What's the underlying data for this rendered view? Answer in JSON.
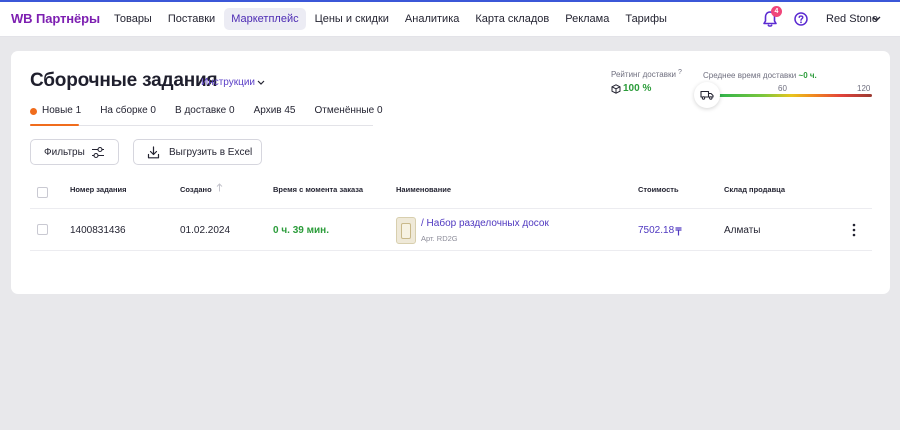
{
  "header": {
    "logo": "WB Партнёры",
    "nav": [
      {
        "label": "Товары",
        "active": false
      },
      {
        "label": "Поставки",
        "active": false
      },
      {
        "label": "Маркетплейс",
        "active": true
      },
      {
        "label": "Цены и скидки",
        "active": false
      },
      {
        "label": "Аналитика",
        "active": false
      },
      {
        "label": "Карта складов",
        "active": false
      },
      {
        "label": "Реклама",
        "active": false
      },
      {
        "label": "Тарифы",
        "active": false
      }
    ],
    "notifications_count": "4",
    "user_name": "Red Stone",
    "icons": {
      "notifications": "bell-icon",
      "help": "help-circle-icon",
      "user_menu": "chevron-down-icon"
    }
  },
  "page": {
    "title": "Сборочные задания",
    "instructions_label": "Инструкции",
    "tabs": [
      {
        "label": "Новые 1",
        "active": true
      },
      {
        "label": "На сборке 0",
        "active": false
      },
      {
        "label": "В доставке 0",
        "active": false
      },
      {
        "label": "Архив 45",
        "active": false
      },
      {
        "label": "Отменённые 0",
        "active": false
      }
    ],
    "delivery_rating": {
      "label": "Рейтинг доставки",
      "hint": "?",
      "value": "100 %"
    },
    "avg_delivery": {
      "label": "Среднее время доставки",
      "value": "~0 ч.",
      "scale_mid": "60",
      "scale_max": "120"
    },
    "buttons": {
      "filters": "Фильтры",
      "export": "Выгрузить в Excel"
    },
    "table": {
      "columns": [
        "Номер задания",
        "Создано",
        "Время с момента заказа",
        "Наименование",
        "Стоимость",
        "Склад продавца"
      ],
      "rows": [
        {
          "id": "1400831436",
          "created": "01.02.2024",
          "time_since_order": "0 ч. 39 мин.",
          "name": "/ Набор разделочных досок",
          "article": "Арт. RD2G",
          "price": "7502.18",
          "currency_sign": "₸",
          "warehouse": "Алматы"
        }
      ]
    }
  },
  "colors": {
    "accent": "#4f38c0",
    "logo": "#7d1fb1",
    "success": "#2b9c3a",
    "tab_indicator": "#f06c1c",
    "badge": "#f0457a"
  }
}
